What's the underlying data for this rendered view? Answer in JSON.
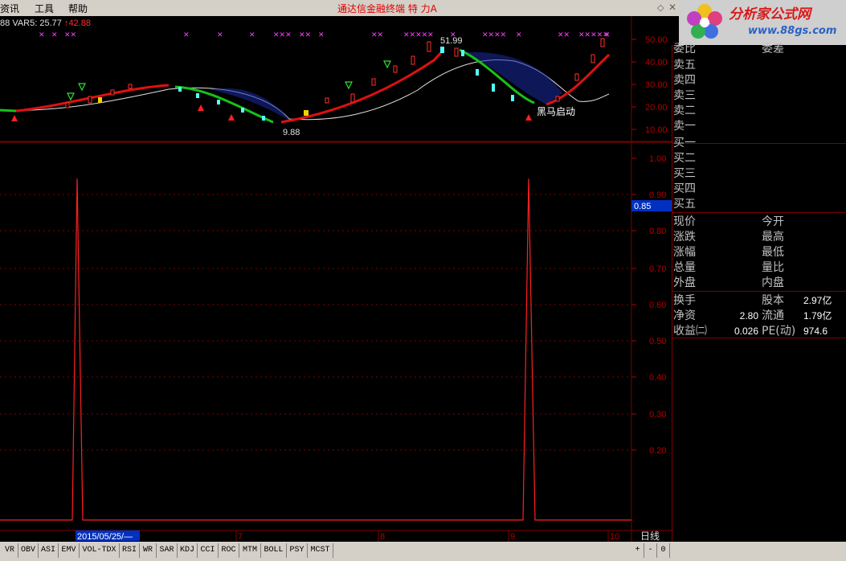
{
  "menu": {
    "items": [
      "资讯",
      "工具",
      "帮助"
    ]
  },
  "app_title": "通达信金融终端  特  力A",
  "logo": {
    "site": "分析家公式网",
    "url": "www.88gs.com"
  },
  "indicator_legend": {
    "prefix": "88",
    "var_label": "VAR5: 25.77",
    "value": "↑42.88"
  },
  "price_axis": {
    "labels": [
      "50.00",
      "40.00",
      "30.00",
      "20.00",
      "10.00"
    ]
  },
  "ind_axis": {
    "labels": [
      "1.00",
      "0.90",
      "0.80",
      "0.70",
      "0.60",
      "0.50",
      "0.40",
      "0.30",
      "0.20"
    ],
    "cursor_value": "0.85"
  },
  "annotations": {
    "high": "51.99",
    "low": "9.88",
    "signal": "黑马启动"
  },
  "date_axis": {
    "cursor_date": "2015/05/25/—",
    "months": [
      "7",
      "8",
      "9",
      "10"
    ],
    "period": "日线"
  },
  "panel": {
    "weibi": "委比",
    "weicha": "委差",
    "sell": [
      "卖五",
      "卖四",
      "卖三",
      "卖二",
      "卖一"
    ],
    "buy": [
      "买一",
      "买二",
      "买三",
      "买四",
      "买五"
    ],
    "quote_left": [
      "现价",
      "涨跌",
      "涨幅",
      "总量",
      "外盘"
    ],
    "quote_right": [
      "今开",
      "最高",
      "最低",
      "量比",
      "内盘"
    ],
    "fund_left_labels": [
      "换手",
      "净资",
      "收益㈡"
    ],
    "fund_left_values": [
      "",
      "2.80",
      "0.026"
    ],
    "fund_right_labels": [
      "股本",
      "流通",
      "PE(动)"
    ],
    "fund_right_values": [
      "2.97亿",
      "1.79亿",
      "974.6"
    ]
  },
  "tabs": [
    "VR",
    "OBV",
    "ASI",
    "EMV",
    "VOL-TDX",
    "RSI",
    "WR",
    "SAR",
    "KDJ",
    "CCI",
    "ROC",
    "MTM",
    "BOLL",
    "PSY",
    "MCST"
  ],
  "tab_controls": [
    "+",
    "-",
    "0"
  ],
  "colors": {
    "up": "#ff3030",
    "down": "#54ffff",
    "grid": "#800000",
    "ma_up": "#e01010",
    "ma_down": "#18c018",
    "white_line": "#e0e0e0",
    "signal": "#ff40ff"
  },
  "chart_data": {
    "type": "line",
    "title": "",
    "ylabel": "",
    "ylim": [
      0.15,
      1.05
    ],
    "x": [
      "2015/05/25",
      "7",
      "8",
      "9",
      "10"
    ],
    "series": [
      {
        "values": [
          0.0,
          1.0,
          0.0,
          0.0,
          0.0,
          0.0,
          0.0,
          0.0,
          1.0,
          0.0
        ]
      }
    ]
  }
}
